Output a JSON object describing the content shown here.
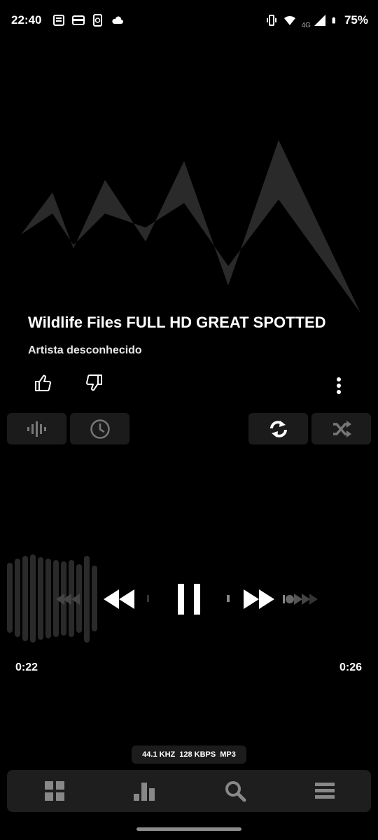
{
  "status_bar": {
    "time": "22:40",
    "network": "4G",
    "battery": "75%",
    "icons": [
      "news-icon",
      "wallet-icon",
      "phone-sync-icon",
      "cloud-icon",
      "vibrate-icon",
      "wifi-icon",
      "signal-icon",
      "battery-icon"
    ]
  },
  "track": {
    "title": "Wildlife Files FULL HD GREAT SPOTTED",
    "artist": "Artista desconhecido"
  },
  "controls": {
    "buttons": [
      "equalizer-icon",
      "sleep-timer-icon",
      "repeat-icon",
      "shuffle-icon"
    ]
  },
  "transport": {
    "icons": [
      "rewind-icon",
      "pause-icon",
      "fast-forward-icon"
    ]
  },
  "progress": {
    "current": "0:22",
    "total": "0:26",
    "fraction": 0.846
  },
  "format": {
    "sample_rate": "44.1 KHZ",
    "bitrate": "128 KBPS",
    "codec": "MP3"
  },
  "bottom_nav": {
    "items": [
      "grid-icon",
      "bars-icon",
      "search-icon",
      "menu-icon"
    ]
  },
  "colors": {
    "background": "#000000",
    "panel": "#1b1b1b",
    "artwork": "#2a2a2a"
  }
}
